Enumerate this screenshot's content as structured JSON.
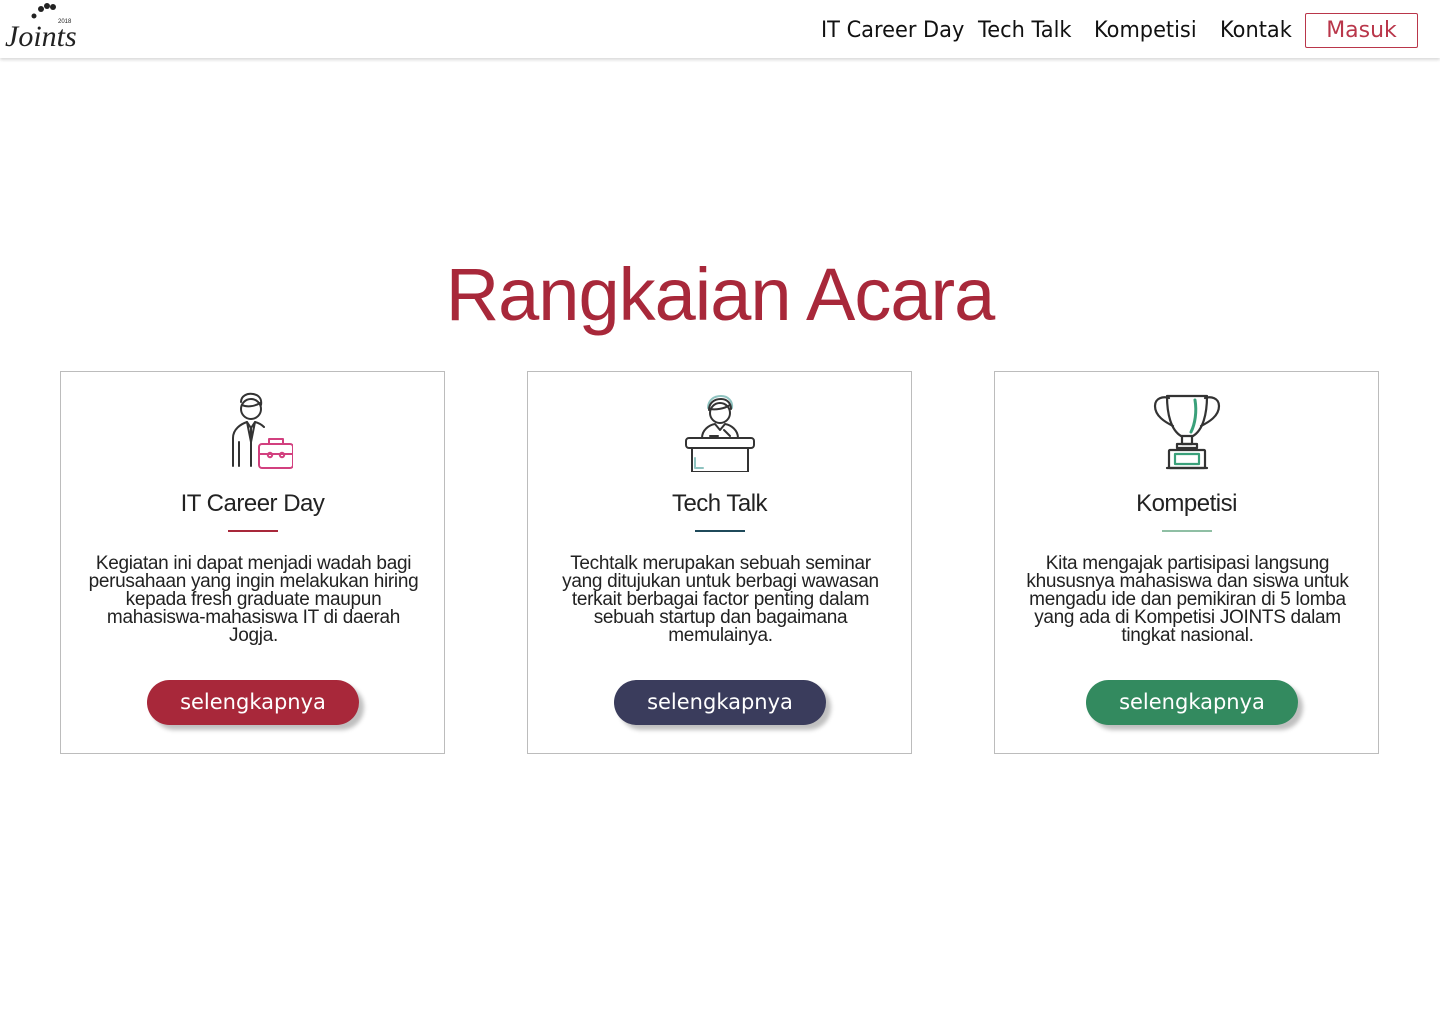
{
  "header": {
    "logo_text": "Joints",
    "logo_year": "2018",
    "nav": [
      {
        "label": "IT Career Day"
      },
      {
        "label": "Tech Talk"
      },
      {
        "label": "Kompetisi"
      },
      {
        "label": "Kontak"
      }
    ],
    "login_label": "Masuk"
  },
  "section": {
    "title": "Rangkaian Acara",
    "cards": [
      {
        "icon": "businessman-briefcase-icon",
        "title": "IT Career Day",
        "description": "Kegiatan ini dapat menjadi wadah bagi perusahaan yang ingin melakukan hiring kepada fresh graduate maupun mahasiswa-mahasiswa IT di daerah Jogja.",
        "button_label": "selengkapnya",
        "accent": "#a8283a"
      },
      {
        "icon": "speaker-podium-icon",
        "title": "Tech Talk",
        "description": "Techtalk merupakan sebuah seminar yang ditujukan untuk berbagi wawasan terkait berbagai factor penting dalam sebuah startup dan bagaimana memulainya.",
        "button_label": "selengkapnya",
        "accent": "#3a3c5c"
      },
      {
        "icon": "trophy-icon",
        "title": "Kompetisi",
        "description": "Kita mengajak partisipasi langsung khususnya mahasiswa dan siswa untuk mengadu ide dan pemikiran di 5 lomba yang ada di Kompetisi JOINTS dalam tingkat nasional.",
        "button_label": "selengkapnya",
        "accent": "#338a5f"
      }
    ]
  },
  "colors": {
    "brand": "#a8283a",
    "nav_text": "#111111",
    "login_border": "#b9364a",
    "tech_talk": "#3a3c5c",
    "kompetisi": "#338a5f",
    "kompetisi_rule": "#8fbfa4"
  }
}
